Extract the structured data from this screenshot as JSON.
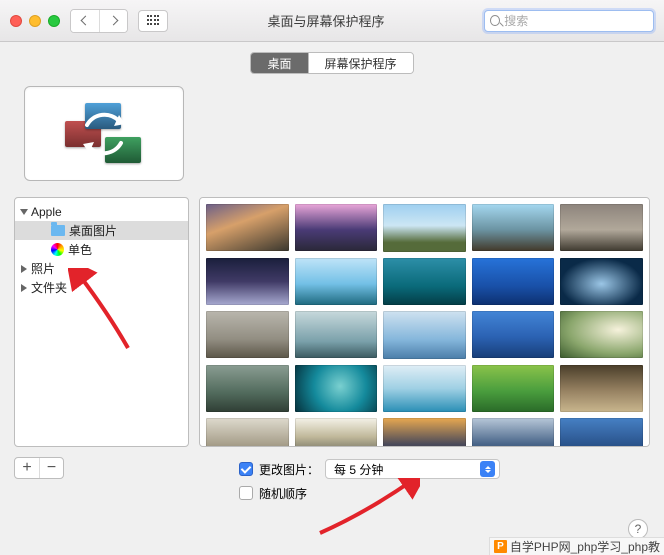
{
  "window": {
    "title": "桌面与屏幕保护程序"
  },
  "search": {
    "placeholder": "搜索"
  },
  "tabs": {
    "desktop": "桌面",
    "screensaver": "屏幕保护程序",
    "active": "desktop"
  },
  "sidebar": {
    "apple": {
      "label": "Apple",
      "expanded": true,
      "children": [
        {
          "id": "desktop-pictures",
          "label": "桌面图片",
          "icon": "folder",
          "selected": true
        },
        {
          "id": "solid-colors",
          "label": "单色",
          "icon": "colorwheel",
          "selected": false
        }
      ]
    },
    "photos": {
      "label": "照片",
      "expanded": false
    },
    "folders": {
      "label": "文件夹",
      "expanded": false
    }
  },
  "options": {
    "changePicture": {
      "label": "更改图片：",
      "checked": true
    },
    "interval": {
      "value": "每 5 分钟"
    },
    "randomOrder": {
      "label": "随机顺序",
      "checked": false
    }
  },
  "buttons": {
    "add": "+",
    "remove": "−",
    "help": "?"
  },
  "thumbnails": [
    "linear-gradient(160deg,#6b5f88 0%,#d7a06a 40%,#3a372e 100%)",
    "linear-gradient(180deg,#e9a6d9 0%,#4a3b76 55%,#2a2838 100%)",
    "linear-gradient(180deg,#9ecff0 0%,#cce6f4 45%,#556b3a 80%)",
    "linear-gradient(180deg,#a5d8f0 0%,#6b93a2 55%,#42392a 100%)",
    "linear-gradient(180deg,#8d847c 0%,#b1a89a 55%,#3f3a30 100%)",
    "linear-gradient(180deg,#1a1f3c 0%,#403a66 50%,#a7a9d0 100%)",
    "linear-gradient(180deg,#bfe4f8 0%,#73c0e6 55%,#1e6a7f 100%)",
    "linear-gradient(180deg,#2d8fa8 0%,#0a6a7a 60%,#033d46 100%)",
    "linear-gradient(180deg,#2773d9 0%,#1950a8 60%,#0d3070 100%)",
    "radial-gradient(ellipse at 50% 55%,#9bc6e6 0%,#0a2a48 70%)",
    "linear-gradient(180deg,#b9b6ad 0%,#928e82 60%,#5c5648 100%)",
    "linear-gradient(180deg,#c7d9dc 0%,#7aa0aa 65%,#3a5a60 100%)",
    "linear-gradient(180deg,#cfe2f0 0%,#84b6db 60%,#4a7da8 100%)",
    "linear-gradient(180deg,#4385d6 0%,#2b62b3 55%,#183e78 100%)",
    "radial-gradient(ellipse at 70% 40%,#f6f2dc 0%,#8aa66c 60%,#3a5a2c 100%)",
    "linear-gradient(180deg,#8a9d92 0%,#516a5c 60%,#2f3e34 100%)",
    "radial-gradient(circle at 55% 45%,#7ad0d0 0%,#148a9c 50%,#052f3a 100%)",
    "linear-gradient(180deg,#e0eef6 0%,#9fd0e4 50%,#2a8eb5 100%)",
    "linear-gradient(180deg,#8bc34a 0%,#4a9e3e 55%,#2a6a28 100%)",
    "linear-gradient(180deg,#4a3e2a 0%,#978262 55%,#c9b68d 100%)",
    "linear-gradient(180deg,#dedacd 0%,#a8a08c 55%,#6a6452 100%)",
    "linear-gradient(180deg,#f4f2e8 0%,#c0b89a 40%,#656658 80%)",
    "linear-gradient(180deg,#e8a850 0%,#4a4a5a 55%,#2b2e3a 100%)",
    "linear-gradient(180deg,#b7c7d8 0%,#4a668a 55%,#1e2e46 100%)",
    "linear-gradient(180deg,#4680c4 0%,#2b558e 55%,#173056 100%)"
  ],
  "footer": {
    "text": "自学PHP网_php学习_php教"
  }
}
